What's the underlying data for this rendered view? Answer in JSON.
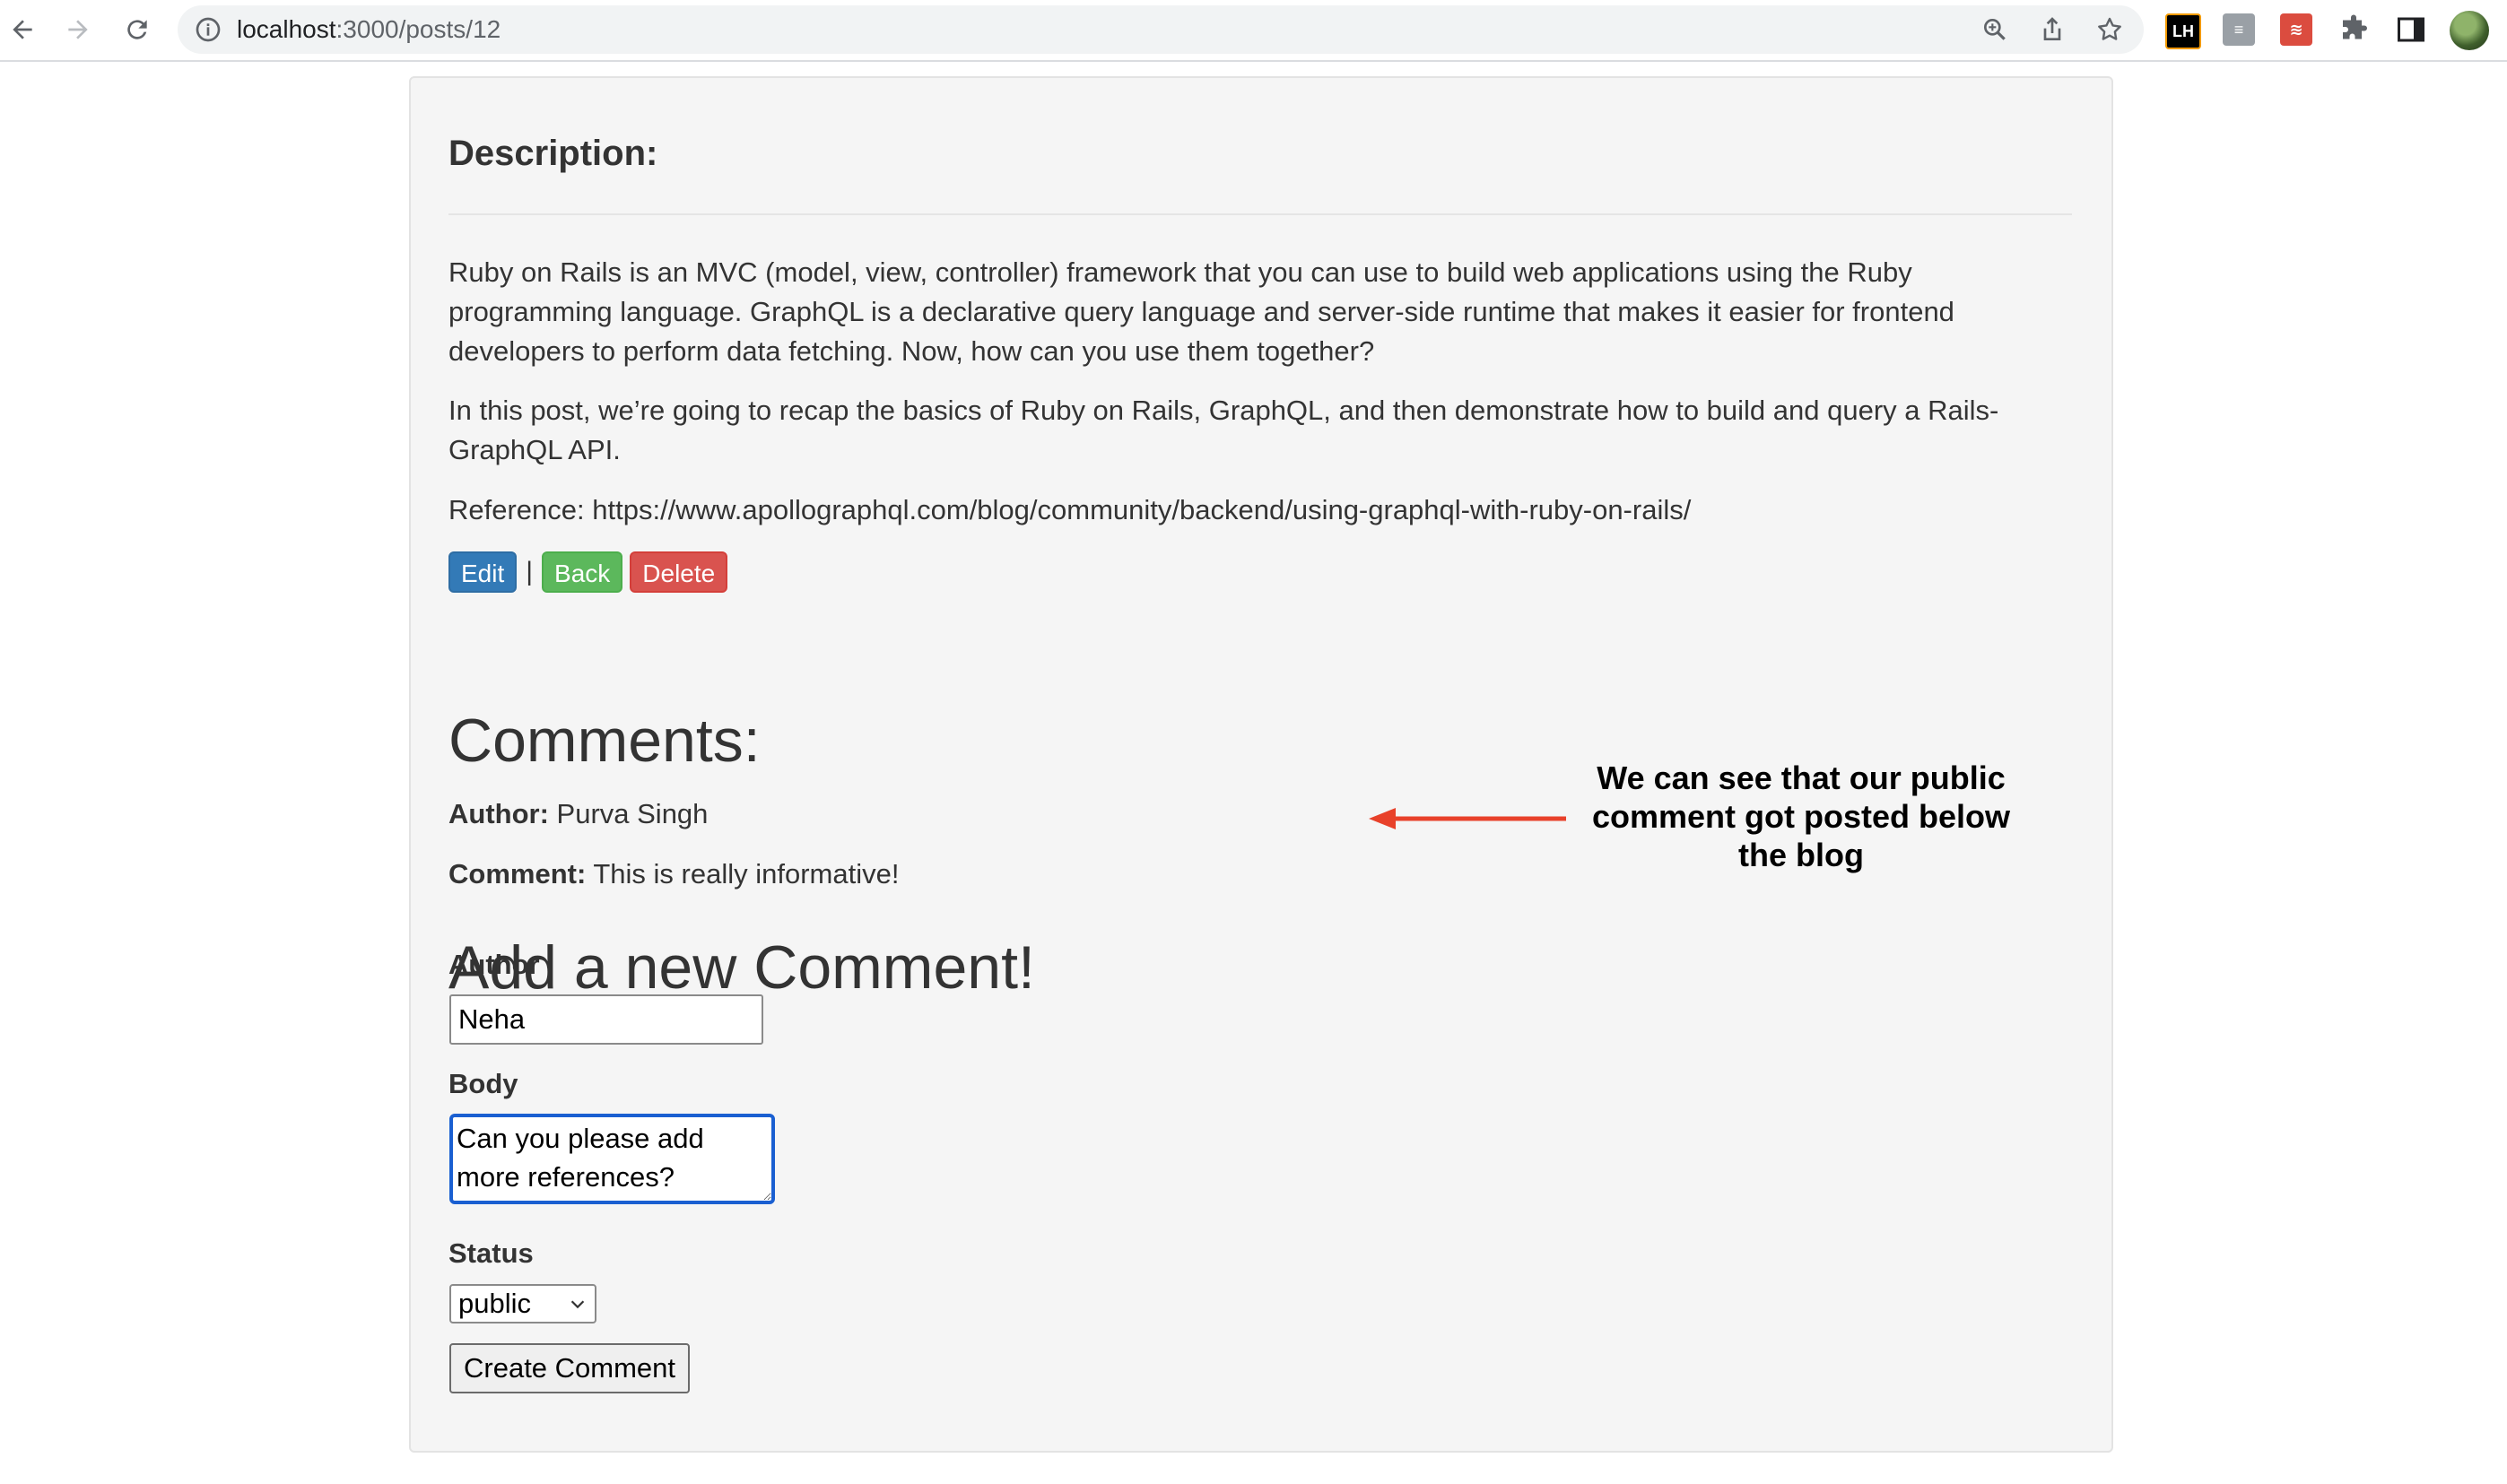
{
  "browser": {
    "url_host": "localhost",
    "url_path": ":3000/posts/12",
    "extensions": [
      {
        "name": "lighthouse-extension",
        "label": "LH",
        "color": "#000000"
      },
      {
        "name": "reader-extension",
        "label": "≡",
        "color": "#9aa0a6"
      },
      {
        "name": "todoist-extension",
        "label": "≋",
        "color": "#db4c3f"
      }
    ]
  },
  "post": {
    "description_heading": "Description:",
    "paragraphs": [
      "Ruby on Rails is an MVC (model, view, controller) framework that you can use to build web applications using the Ruby programming language. GraphQL is a declarative query language and server-side runtime that makes it easier for frontend developers to perform data fetching. Now, how can you use them together?",
      "In this post, we’re going to recap the basics of Ruby on Rails, GraphQL, and then demonstrate how to build and query a Rails-GraphQL API.",
      "Reference: https://www.apollographql.com/blog/community/backend/using-graphql-with-ruby-on-rails/"
    ],
    "actions": {
      "edit": "Edit",
      "separator": "|",
      "back": "Back",
      "delete": "Delete"
    }
  },
  "comments": {
    "heading": "Comments:",
    "items": [
      {
        "author_label": "Author:",
        "author": "Purva Singh",
        "comment_label": "Comment:",
        "comment": "This is really informative!"
      }
    ]
  },
  "annotation": {
    "text": "We can see that our public comment got posted below the blog",
    "arrow_color": "#e8412a"
  },
  "new_comment_form": {
    "heading": "Add a new Comment!",
    "author_label": "Author",
    "author_value": "Neha",
    "body_label": "Body",
    "body_value": "Can you please add more references?",
    "status_label": "Status",
    "status_value": "public",
    "submit_label": "Create Comment"
  }
}
